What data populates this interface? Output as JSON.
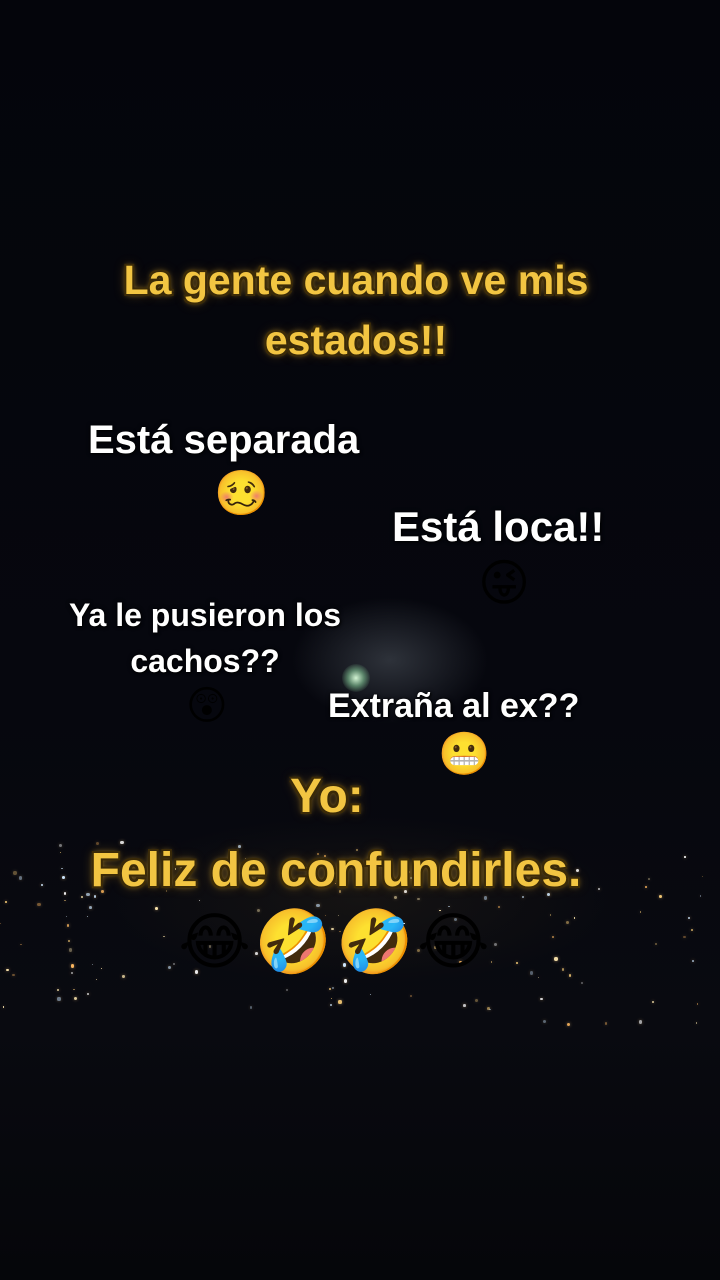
{
  "captions": {
    "title_line1": "La gente cuando ve mis",
    "title_line2": "estados!!",
    "separada": "Está separada",
    "separada_emoji": "🥴",
    "loca": "Está loca!!",
    "loca_emoji": "😜",
    "cachos_line1": "Ya le pusieron los",
    "cachos_line2": "cachos??",
    "cachos_emoji": "😲",
    "ex": "Extraña al ex??",
    "ex_emoji": "😬",
    "yo": "Yo:",
    "feliz": "Feliz de confundirles.",
    "laugh_emojis": "😂🤣🤣😂"
  },
  "colors": {
    "gold_text": "#f2c542",
    "white_text": "#ffffff",
    "background": "#05060c"
  }
}
